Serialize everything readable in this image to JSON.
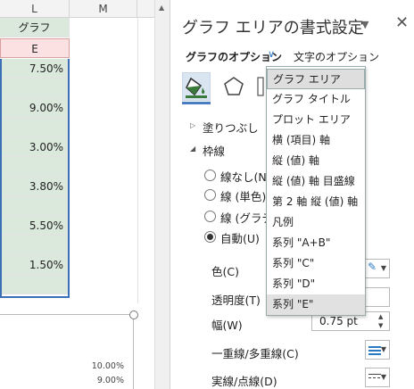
{
  "sheet": {
    "columns": [
      {
        "label": "L"
      },
      {
        "label": "M"
      }
    ],
    "header_cell": "グラフ",
    "header_cell2": "E",
    "values": [
      "7.50%",
      "",
      "9.00%",
      "",
      "3.00%",
      "",
      "3.80%",
      "",
      "5.50%",
      "",
      "1.50%",
      ""
    ]
  },
  "chart": {
    "y_labels": [
      "10.00%",
      "9.00%"
    ]
  },
  "pane": {
    "title": "グラフ エリアの書式設定",
    "options_label": "グラフのオプション",
    "text_options_label": "文字のオプション",
    "fill_label": "塗りつぶし",
    "border_label": "枠線",
    "radios": [
      {
        "label": "線なし(N)",
        "selected": false
      },
      {
        "label": "線 (単色)(S)",
        "selected": false
      },
      {
        "label": "線 (グラデーション)(G)",
        "selected": false
      },
      {
        "label": "自動(U)",
        "selected": true
      }
    ],
    "color_label": "色(C)",
    "transparency_label": "透明度(T)",
    "width_label": "幅(W)",
    "width_value": "0.75 pt",
    "compound_label": "一重線/多重線(C)",
    "dash_label": "実線/点線(D)"
  },
  "dropdown": {
    "items": [
      "グラフ エリア",
      "グラフ タイトル",
      "プロット エリア",
      "横 (項目) 軸",
      "縦 (値) 軸",
      "縦 (値) 軸 目盛線",
      "第 2 軸 縦 (値) 軸",
      "凡例",
      "系列 \"A+B\"",
      "系列 \"C\"",
      "系列 \"D\"",
      "系列 \"E\""
    ],
    "selected": "グラフ エリア",
    "hovered": "系列 \"E\""
  },
  "colors": {
    "accent": "#2b79c2",
    "highlight": "#ffff66",
    "cell_fill": "#dbe8dc",
    "header_fill": "#fbe1e1"
  }
}
